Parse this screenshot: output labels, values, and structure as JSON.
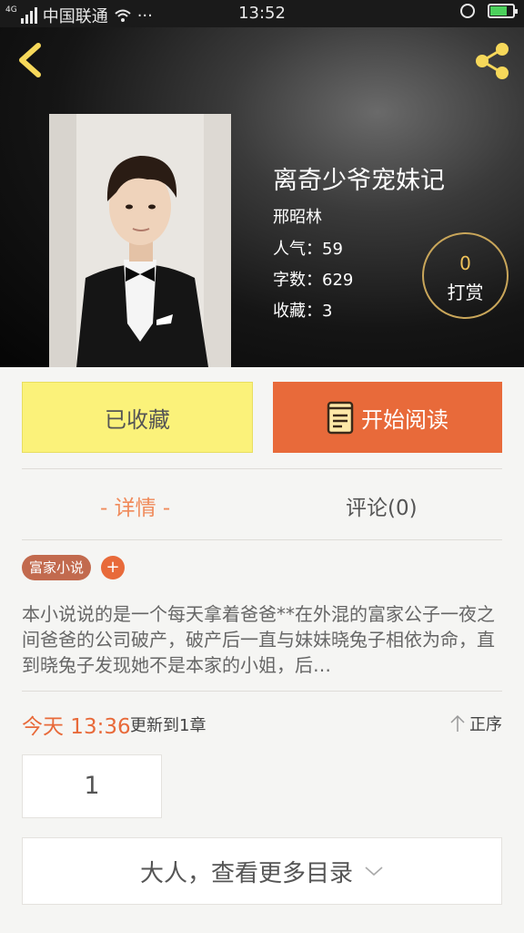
{
  "status_bar": {
    "network_type": "4G",
    "carrier": "中国联通",
    "more": "···",
    "time": "13:52"
  },
  "book": {
    "title": "离奇少爷宠妹记",
    "author": "邢昭林",
    "popularity": "人气：59",
    "word_count": "字数：629",
    "favorites": "收藏：3",
    "tip_count": "0",
    "tip_label": "打赏"
  },
  "actions": {
    "favorited_label": "已收藏",
    "start_reading_label": "开始阅读"
  },
  "tabs": {
    "details": "- 详情 -",
    "comments": "评论(0)"
  },
  "tag": {
    "label": "富家小说",
    "add": "+"
  },
  "description": "本小说说的是一个每天拿着爸爸**在外混的富家公子一夜之间爸爸的公司破产，破产后一直与妹妹晓兔子相依为命，直到晓兔子发现她不是本家的小姐，后…",
  "update": {
    "time": "今天 13:36",
    "text": "更新到1章",
    "sort_label": "正序"
  },
  "chapters": [
    "1"
  ],
  "more_catalog_label": "大人，查看更多目录",
  "colors": {
    "accent": "#e86a3a",
    "favorite_bg": "#fbf27a",
    "tab_active": "#f08a5a",
    "tag_bg": "#c26a4e"
  }
}
